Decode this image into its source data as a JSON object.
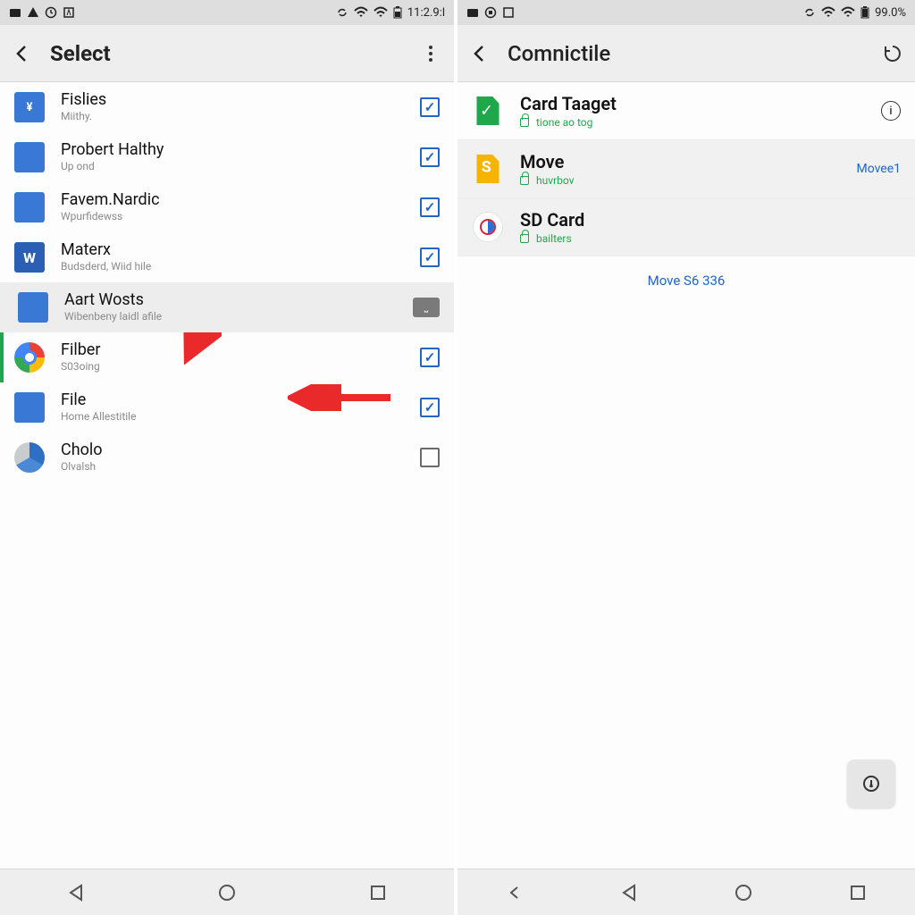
{
  "left": {
    "statusbar": {
      "time": "11:2.9:l"
    },
    "title": "Select",
    "items": [
      {
        "title": "Fislies",
        "sub": "Miithy.",
        "icon": "doc-blue",
        "glyph": "¥",
        "checked": true,
        "highlight": false
      },
      {
        "title": "Probert Halthy",
        "sub": "Up ond",
        "icon": "doc-blue",
        "glyph": "",
        "checked": true,
        "highlight": false
      },
      {
        "title": "Favem.Nardic",
        "sub": "Wpurfidewss",
        "icon": "doc-blue",
        "glyph": "",
        "checked": true,
        "highlight": false
      },
      {
        "title": "Materx",
        "sub": "Budsderd, Wiid hile",
        "icon": "doc-w",
        "glyph": "W",
        "checked": true,
        "highlight": false
      },
      {
        "title": "Aart Wosts",
        "sub": "Wibenbeny laidl afile",
        "icon": "doc-blue",
        "glyph": "",
        "checked": false,
        "highlight": true,
        "tag": true
      },
      {
        "title": "Filber",
        "sub": "S03oing",
        "icon": "chrome",
        "glyph": "",
        "checked": true,
        "highlight": false,
        "leftbar": true
      },
      {
        "title": "File",
        "sub": "Home Allestitile",
        "icon": "doc-blue",
        "glyph": "",
        "checked": true,
        "highlight": false
      },
      {
        "title": "Cholo",
        "sub": "Olvalsh",
        "icon": "pie",
        "glyph": "",
        "checked": false,
        "highlight": false,
        "emptybox": true
      }
    ]
  },
  "right": {
    "statusbar": {
      "battery": "99.0%"
    },
    "title": "Comnictile",
    "destinations": [
      {
        "title": "Card Taaget",
        "sub": "tione ao tog",
        "kind": "card",
        "right": "info"
      },
      {
        "title": "Move",
        "sub": "huvrbov",
        "kind": "sfile",
        "right": "link",
        "rightLabel": "Movee1",
        "sel": true
      },
      {
        "title": "SD Card",
        "sub": "bailters",
        "kind": "sd",
        "right": "",
        "sel": true
      }
    ],
    "footer": "Move S6 336"
  }
}
